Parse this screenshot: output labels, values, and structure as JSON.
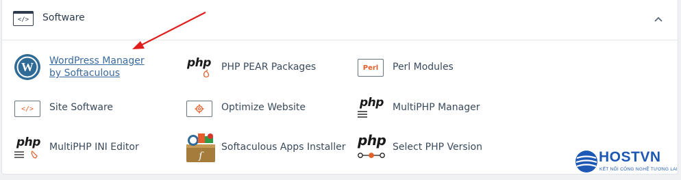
{
  "header": {
    "title": "Software",
    "header_icon_glyph": "</>",
    "icon": "code-window-icon",
    "collapse_icon": "chevron-up-icon"
  },
  "items": {
    "wordpress_manager": {
      "label": "WordPress Manager by Softaculous",
      "icon": "wordpress-icon"
    },
    "php_pear": {
      "label": "PHP PEAR Packages",
      "icon": "php-pear-icon",
      "icon_text": "php"
    },
    "perl_modules": {
      "label": "Perl Modules",
      "icon": "perl-icon",
      "icon_text": "Perl"
    },
    "site_software": {
      "label": "Site Software",
      "icon": "code-box-icon",
      "icon_text": "</>"
    },
    "optimize_website": {
      "label": "Optimize Website",
      "icon": "gear-box-icon"
    },
    "multiphp_manager": {
      "label": "MultiPHP Manager",
      "icon": "php-manager-icon",
      "icon_text": "php"
    },
    "multiphp_ini": {
      "label": "MultiPHP INI Editor",
      "icon": "php-ini-icon",
      "icon_text": "php"
    },
    "softaculous": {
      "label": "Softaculous Apps Installer",
      "icon": "softaculous-icon"
    },
    "select_php": {
      "label": "Select PHP Version",
      "icon": "php-version-icon",
      "icon_text": "php"
    }
  },
  "watermark": {
    "name": "HOSTVN",
    "tagline": "KẾT NỐI CÔNG NGHỆ TƯƠNG LAI",
    "color": "#1d58b4"
  },
  "colors": {
    "accent_orange": "#e2602a",
    "link_blue": "#3a6a9e",
    "arrow_red": "#e01e1e"
  }
}
